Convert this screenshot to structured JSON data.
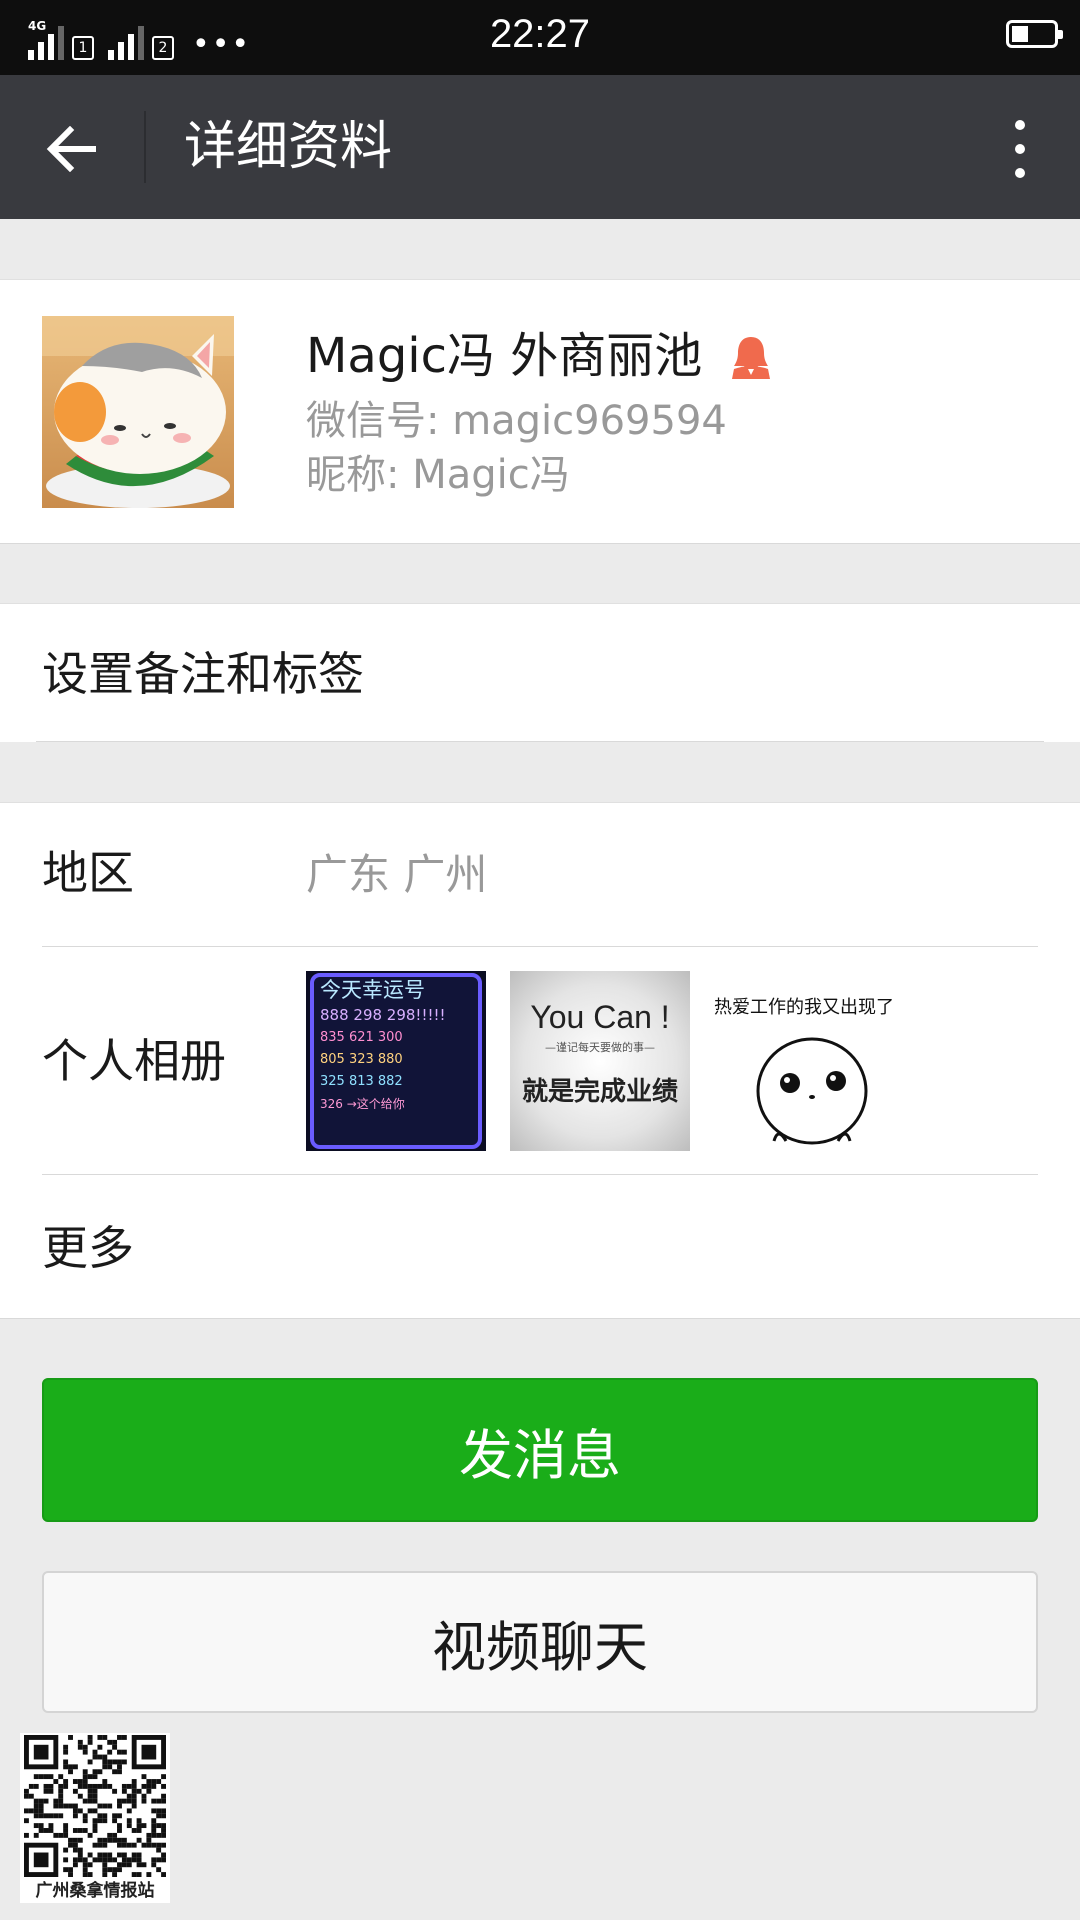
{
  "status_bar": {
    "network_type": "4G",
    "sim1_label": "1",
    "sim2_label": "2",
    "more_dots": "•••",
    "time": "22:27",
    "battery_level": 0.4
  },
  "header": {
    "title": "详细资料"
  },
  "profile": {
    "name": "Magic冯 外商丽池",
    "wechat_id": "微信号: magic969594",
    "nickname": "昵称: Magic冯",
    "gender_icon_color": "#f06a4d"
  },
  "remark": {
    "label": "设置备注和标签"
  },
  "info": {
    "region_label": "地区",
    "region_value": "广东  广州",
    "album_label": "个人相册",
    "album_photos": [
      {
        "lines": [
          "今天幸运号",
          "888 298 298!!!!!",
          "835 621 300",
          "805 323 880",
          "325 813 882",
          "326 →这个给你"
        ]
      },
      {
        "heading": "You Can !",
        "subheading": "—谨记每天要做的事—",
        "main": "就是完成业绩"
      },
      {
        "caption": "热爱工作的我又出现了"
      }
    ],
    "more_label": "更多"
  },
  "actions": {
    "send_message": "发消息",
    "video_chat": "视频聊天"
  },
  "watermark": {
    "text": "广州桑拿情报站"
  },
  "colors": {
    "primary_green": "#1aad19",
    "header_bg": "#393a3f",
    "page_bg": "#ebebeb"
  }
}
